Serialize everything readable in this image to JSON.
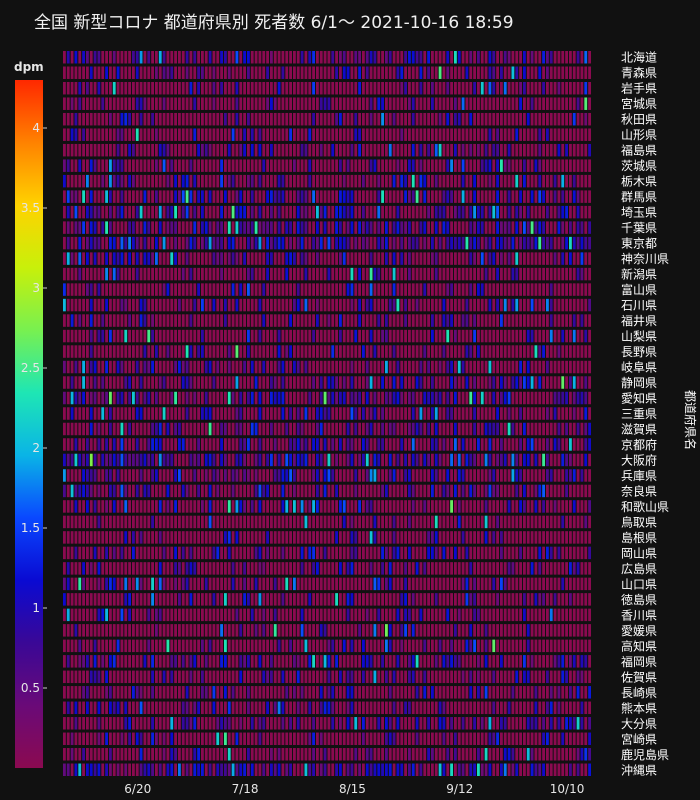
{
  "title": "全国 新型コロナ 都道府県別 死者数 6/1～  2021-10-16 18:59",
  "chart_data": {
    "type": "heatmap",
    "title": "全国 新型コロナ 都道府県別 死者数 6/1～  2021-10-16 18:59",
    "ylabel": "都道府県名",
    "colorbar": {
      "title": "dpm",
      "range": [
        0,
        4.3
      ],
      "ticks": [
        0.5,
        1,
        1.5,
        2,
        2.5,
        3,
        3.5,
        4
      ],
      "tick_labels": [
        "0.5",
        "1",
        "1.5",
        "2",
        "2.5",
        "3",
        "3.5",
        "4"
      ],
      "colorscale": [
        "#8b0a50",
        "#6a0a78",
        "#3a0896",
        "#0a0ad2",
        "#0a48ff",
        "#0ab4e6",
        "#1ee6b4",
        "#78f050",
        "#c8f00a",
        "#ffd200",
        "#ff8200",
        "#ff2800"
      ]
    },
    "x": {
      "start": "2021-06-01",
      "end": "2021-10-16",
      "tick_dates": [
        "2021-06-20",
        "2021-07-18",
        "2021-08-15",
        "2021-09-12",
        "2021-10-10"
      ],
      "tick_labels": [
        "6/20",
        "7/18",
        "8/15",
        "9/12",
        "10/10"
      ]
    },
    "prefectures": [
      "北海道",
      "青森県",
      "岩手県",
      "宮城県",
      "秋田県",
      "山形県",
      "福島県",
      "茨城県",
      "栃木県",
      "群馬県",
      "埼玉県",
      "千葉県",
      "東京都",
      "神奈川県",
      "新潟県",
      "富山県",
      "石川県",
      "福井県",
      "山梨県",
      "長野県",
      "岐阜県",
      "静岡県",
      "愛知県",
      "三重県",
      "滋賀県",
      "京都府",
      "大阪府",
      "兵庫県",
      "奈良県",
      "和歌山県",
      "鳥取県",
      "島根県",
      "岡山県",
      "広島県",
      "山口県",
      "徳島県",
      "香川県",
      "愛媛県",
      "高知県",
      "福岡県",
      "佐賀県",
      "長崎県",
      "熊本県",
      "大分県",
      "宮崎県",
      "鹿児島県",
      "沖縄県"
    ],
    "base_levels": [
      0.55,
      0.3,
      0.25,
      0.3,
      0.2,
      0.2,
      0.35,
      0.35,
      0.4,
      0.5,
      0.6,
      0.7,
      0.9,
      0.6,
      0.2,
      0.2,
      0.35,
      0.2,
      0.25,
      0.3,
      0.4,
      0.45,
      0.6,
      0.4,
      0.45,
      0.5,
      0.9,
      0.6,
      0.45,
      0.4,
      0.15,
      0.15,
      0.35,
      0.35,
      0.35,
      0.25,
      0.3,
      0.25,
      0.3,
      0.5,
      0.3,
      0.3,
      0.4,
      0.5,
      0.3,
      0.35,
      0.8
    ]
  }
}
